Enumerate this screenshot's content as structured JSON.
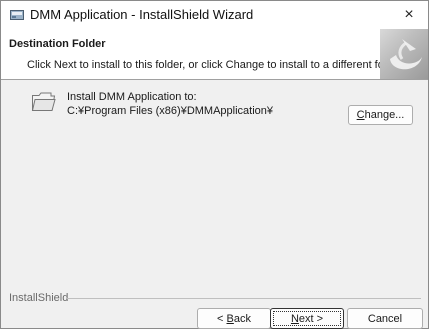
{
  "window": {
    "title": "DMM Application - InstallShield Wizard",
    "close_glyph": "×"
  },
  "header": {
    "title": "Destination Folder",
    "subtitle": "Click Next to install to this folder, or click Change to install to a different folder."
  },
  "content": {
    "install_label": "Install DMM Application to:",
    "install_path": "C:¥Program Files (x86)¥DMMApplication¥",
    "change_button": {
      "prefix": "",
      "mnemonic": "C",
      "rest": "hange..."
    }
  },
  "footer": {
    "brand": "InstallShield",
    "back_button": {
      "prefix": "< ",
      "mnemonic": "B",
      "rest": "ack"
    },
    "next_button": {
      "prefix": "",
      "mnemonic": "N",
      "rest": "ext >"
    },
    "cancel_button": "Cancel"
  },
  "icons": {
    "app": "installer-app-icon",
    "folder": "folder-icon",
    "header_art": "installshield-swirl-icon",
    "close": "close-icon"
  }
}
